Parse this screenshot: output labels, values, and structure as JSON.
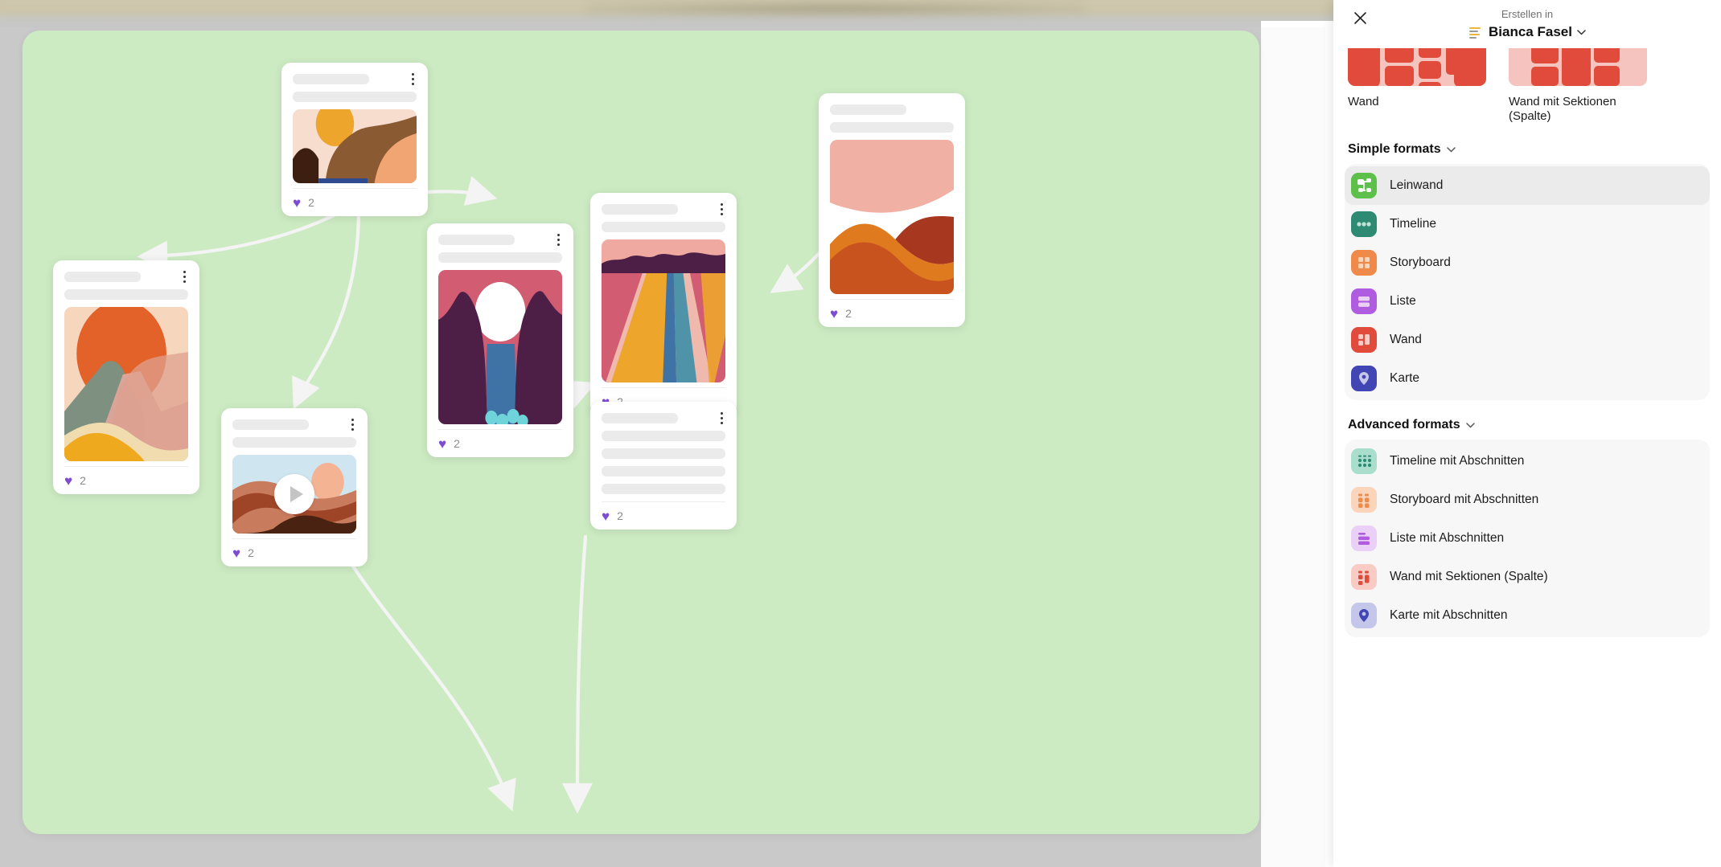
{
  "panel": {
    "close_icon": "close-icon",
    "create_in_label": "Erstellen in",
    "space_name": "Bianca Fasel",
    "space_caret": "⌄",
    "thumbnails": [
      {
        "label": "Wand",
        "icon": "wall-layout-thumb",
        "color": "#e14b3c",
        "light": "#f6c4bf"
      },
      {
        "label": "Wand mit Sektionen (Spalte)",
        "icon": "wall-sections-layout-thumb",
        "color": "#e14b3c",
        "light": "#f6c4bf"
      }
    ],
    "sections": [
      {
        "title": "Simple formats",
        "items": [
          {
            "label": "Leinwand",
            "icon": "canvas-icon",
            "color": "#5cc04a",
            "glyph": "#ffffff",
            "selected": true
          },
          {
            "label": "Timeline",
            "icon": "timeline-icon",
            "color": "#2f8a73",
            "glyph": "#bfe2d8",
            "selected": false
          },
          {
            "label": "Storyboard",
            "icon": "storyboard-icon",
            "color": "#f08a4b",
            "glyph": "#fbd5bb",
            "selected": false
          },
          {
            "label": "Liste",
            "icon": "list-icon",
            "color": "#b05ce0",
            "glyph": "#ead0f7",
            "selected": false
          },
          {
            "label": "Wand",
            "icon": "wall-icon",
            "color": "#e14b3c",
            "glyph": "#f8cbc5",
            "selected": false
          },
          {
            "label": "Karte",
            "icon": "map-icon",
            "color": "#4246b4",
            "glyph": "#c5c7ea",
            "selected": false
          }
        ]
      },
      {
        "title": "Advanced formats",
        "items": [
          {
            "label": "Timeline mit Abschnitten",
            "icon": "timeline-sections-icon",
            "color": "#a9ddcc",
            "glyph": "#2f8a73",
            "selected": false
          },
          {
            "label": "Storyboard mit Abschnitten",
            "icon": "storyboard-sections-icon",
            "color": "#fbd5bb",
            "glyph": "#f08a4b",
            "selected": false
          },
          {
            "label": "Liste mit Abschnitten",
            "icon": "list-sections-icon",
            "color": "#ead0f7",
            "glyph": "#b05ce0",
            "selected": false
          },
          {
            "label": "Wand mit Sektionen (Spalte)",
            "icon": "wall-sections-icon",
            "color": "#f8cbc5",
            "glyph": "#e14b3c",
            "selected": false
          },
          {
            "label": "Karte mit Abschnitten",
            "icon": "map-sections-icon",
            "color": "#c5c7ea",
            "glyph": "#4246b4",
            "selected": false
          }
        ]
      }
    ]
  },
  "canvas": {
    "background_color": "#cdebc3",
    "cards": [
      {
        "id": "card-desert",
        "like_count": "2",
        "heart": "♥",
        "kebab": "more-options",
        "media": "image"
      },
      {
        "id": "card-sunset",
        "like_count": "2",
        "heart": "♥",
        "kebab": "more-options",
        "media": "image"
      },
      {
        "id": "card-canyon",
        "like_count": "2",
        "heart": "♥",
        "kebab": "more-options",
        "media": "image"
      },
      {
        "id": "card-road",
        "like_count": "2",
        "heart": "♥",
        "kebab": "more-options",
        "media": "image"
      },
      {
        "id": "card-video",
        "like_count": "2",
        "heart": "♥",
        "kebab": "more-options",
        "media": "video"
      },
      {
        "id": "card-text",
        "like_count": "2",
        "heart": "♥",
        "kebab": "more-options",
        "media": "none"
      },
      {
        "id": "card-dunes",
        "like_count": "2",
        "heart": "♥",
        "kebab": "more-options",
        "media": "image"
      }
    ]
  }
}
